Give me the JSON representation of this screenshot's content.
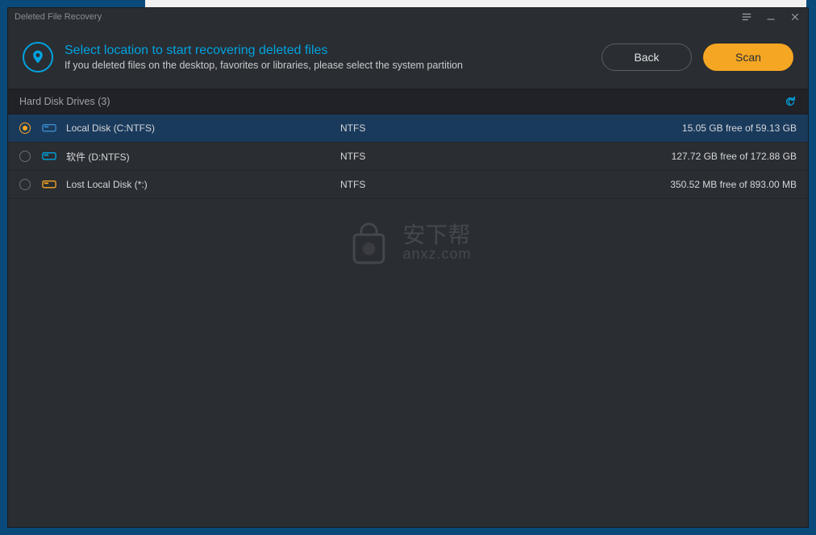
{
  "window": {
    "title": "Deleted File Recovery"
  },
  "header": {
    "title": "Select location to start recovering deleted files",
    "subtitle": "If you deleted files on the desktop, favorites or libraries, please select the system partition",
    "back_label": "Back",
    "scan_label": "Scan"
  },
  "section": {
    "label": "Hard Disk Drives (3)"
  },
  "drives": [
    {
      "name": "Local Disk (C:NTFS)",
      "fs": "NTFS",
      "free": "15.05 GB free of 59.13 GB",
      "selected": true,
      "icon_color": "#3a8dd0"
    },
    {
      "name": "软件 (D:NTFS)",
      "fs": "NTFS",
      "free": "127.72 GB free of 172.88 GB",
      "selected": false,
      "icon_color": "#00a3e0"
    },
    {
      "name": "Lost Local Disk (*:)",
      "fs": "NTFS",
      "free": "350.52 MB free of 893.00 MB",
      "selected": false,
      "icon_color": "#f5a623"
    }
  ],
  "watermark": {
    "text_top": "安下帮",
    "text_bottom": "anxz.com"
  }
}
